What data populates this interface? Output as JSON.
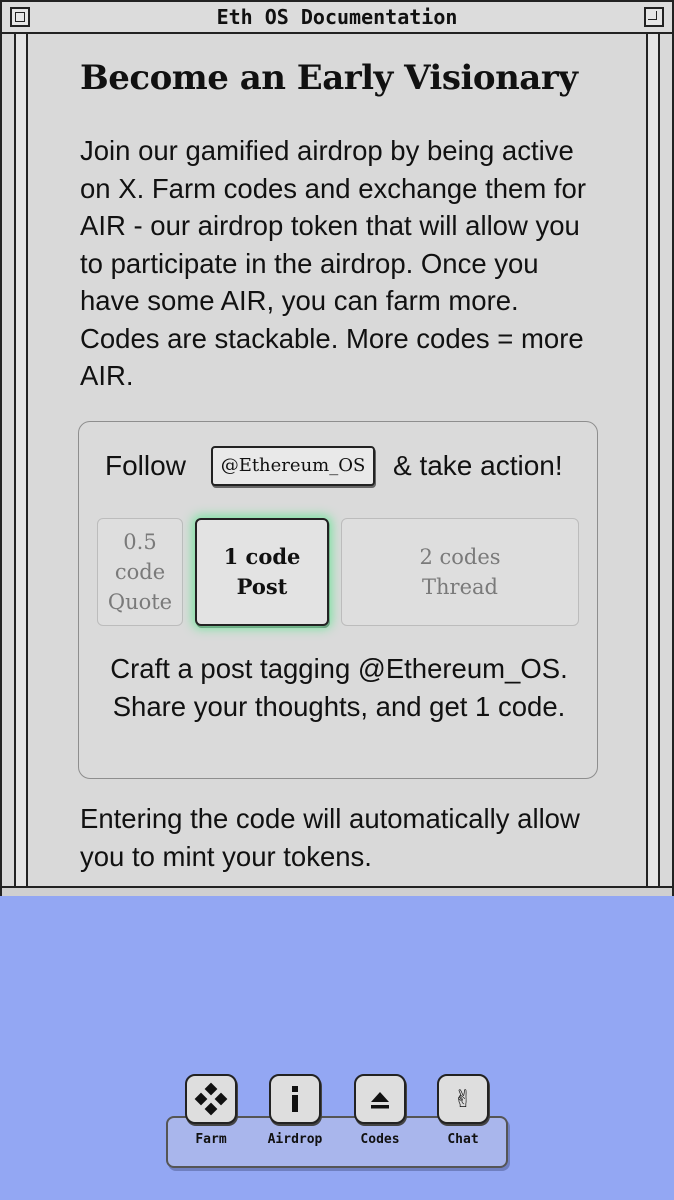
{
  "window": {
    "title": "Eth OS Documentation"
  },
  "content": {
    "heading": "Become an Early Visionary",
    "intro": "Join our gamified airdrop by being active on X. Farm codes and exchange them for AIR - our airdrop token that will allow you to participate in the airdrop. Once you have some AIR, you can farm more. Codes are stackable. More codes = more AIR.",
    "outro": "Entering the code will automatically allow you to mint your tokens."
  },
  "card": {
    "follow_label": "Follow",
    "handle": "@Ethereum_OS",
    "action_label": "& take action!",
    "options": [
      {
        "amount": "0.5 code",
        "type": "Quote",
        "selected": false
      },
      {
        "amount": "1 code",
        "type": "Post",
        "selected": true
      },
      {
        "amount": "2 codes",
        "type": "Thread",
        "selected": false
      }
    ],
    "description": "Craft a post tagging @Ethereum_OS. Share your thoughts, and get 1 code."
  },
  "dock": {
    "items": [
      {
        "label": "Farm",
        "icon": "farm-diamond-icon"
      },
      {
        "label": "Airdrop",
        "icon": "info-icon"
      },
      {
        "label": "Codes",
        "icon": "eject-icon"
      },
      {
        "label": "Chat",
        "icon": "peace-hand-icon"
      }
    ]
  },
  "colors": {
    "desktop": "#93a7f3",
    "window": "#d9d9d9",
    "selected_glow": "#7fe3a4"
  }
}
